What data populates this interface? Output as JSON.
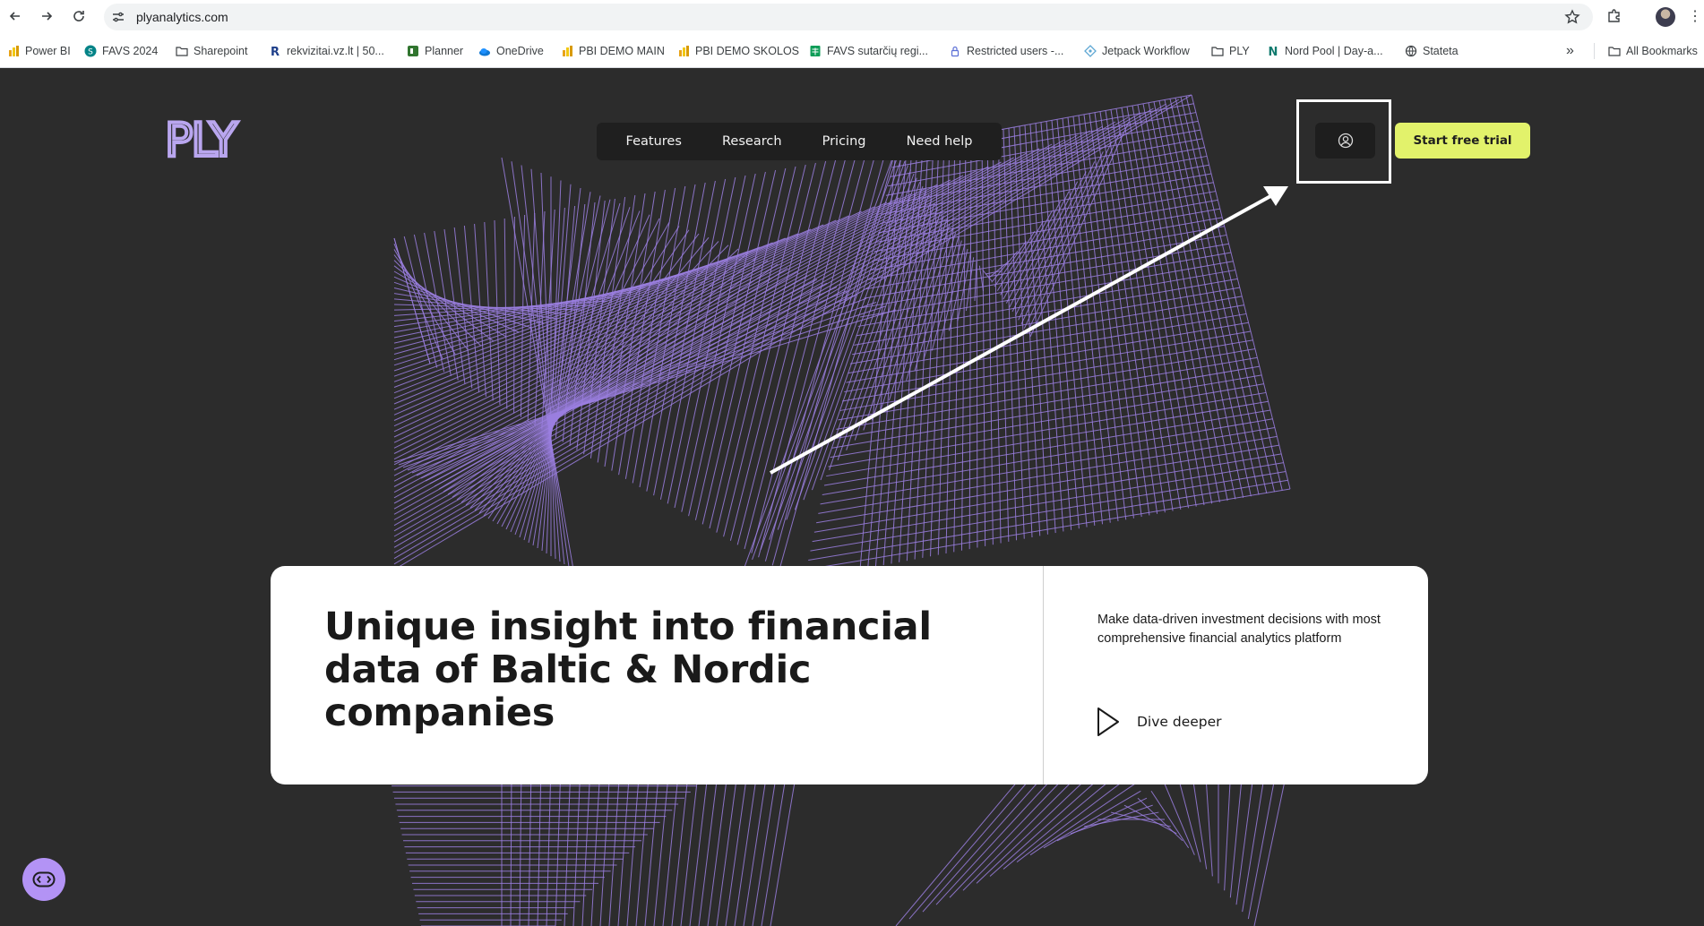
{
  "browser": {
    "url": "plyanalytics.com",
    "icons": {
      "back": "arrow-left-icon",
      "forward": "arrow-right-icon",
      "reload": "reload-icon",
      "site_info": "tune-icon",
      "bookmark_star": "star-icon",
      "extensions": "puzzle-icon",
      "menu": "kebab-menu-icon"
    }
  },
  "bookmarks": [
    {
      "label": "Power BI",
      "icon": "powerbi-icon"
    },
    {
      "label": "FAVS 2024",
      "icon": "sharepoint-icon"
    },
    {
      "label": "Sharepoint",
      "icon": "folder-icon"
    },
    {
      "label": "rekvizitai.vz.lt | 50...",
      "icon": "r-icon"
    },
    {
      "label": "Planner",
      "icon": "planner-icon"
    },
    {
      "label": "OneDrive",
      "icon": "onedrive-icon"
    },
    {
      "label": "PBI DEMO MAIN",
      "icon": "powerbi-icon"
    },
    {
      "label": "PBI DEMO SKOLOS",
      "icon": "powerbi-icon"
    },
    {
      "label": "FAVS sutarčių regi...",
      "icon": "sheets-icon"
    },
    {
      "label": "Restricted users -...",
      "icon": "lock-icon"
    },
    {
      "label": "Jetpack Workflow",
      "icon": "jetpack-icon"
    },
    {
      "label": "PLY",
      "icon": "folder-icon"
    },
    {
      "label": "Nord Pool | Day-a...",
      "icon": "n-icon"
    },
    {
      "label": "Stateta",
      "icon": "globe-icon"
    }
  ],
  "bookmarks_overflow": "»",
  "all_bookmarks": "All Bookmarks",
  "site": {
    "logo": "PLY",
    "nav": [
      "Features",
      "Research",
      "Pricing",
      "Need help"
    ],
    "cta": "Start free trial",
    "hero": {
      "title": "Unique insight into financial data of Baltic & Nordic companies",
      "description": "Make data-driven investment decisions with most comprehensive financial analytics platform",
      "action": "Dive deeper"
    },
    "colors": {
      "background": "#2c2c2c",
      "accent": "#e2f26b",
      "mesh": "#9b7fe0",
      "logo": "#b9a6ef",
      "chat": "#b393f5"
    }
  }
}
